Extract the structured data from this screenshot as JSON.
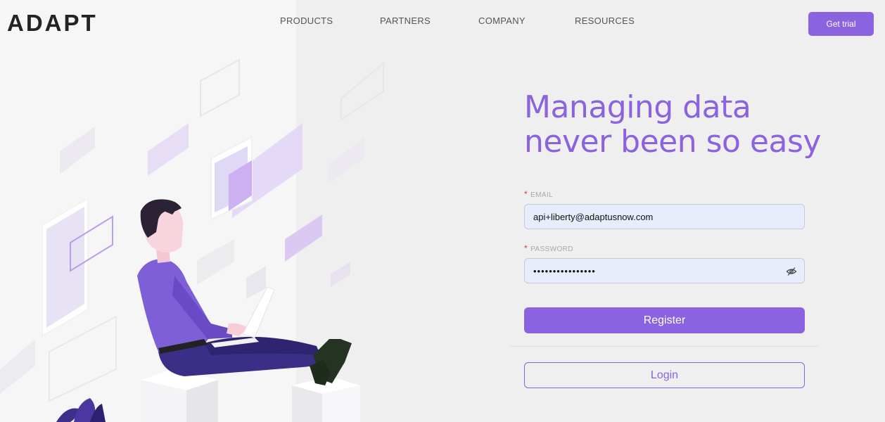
{
  "brand": {
    "logo_text": "ADAPT",
    "accent_color": "#8b62e0"
  },
  "nav": {
    "items": [
      {
        "label": "PRODUCTS"
      },
      {
        "label": "PARTNERS"
      },
      {
        "label": "COMPANY"
      },
      {
        "label": "RESOURCES"
      }
    ],
    "cta_label": "Get trial"
  },
  "hero": {
    "headline_line1": "Managing data",
    "headline_line2": "never been so easy"
  },
  "form": {
    "email": {
      "label": "EMAIL",
      "required_mark": "*",
      "value": "api+liberty@adaptusnow.com"
    },
    "password": {
      "label": "PASSWORD",
      "required_mark": "*",
      "value": "••••••••••••••••",
      "toggle_icon": "eye-off-icon"
    },
    "register_label": "Register",
    "login_label": "Login"
  }
}
